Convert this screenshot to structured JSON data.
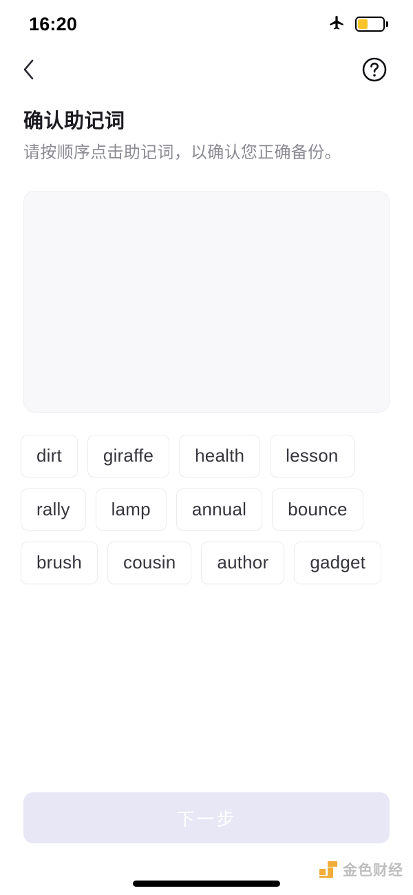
{
  "status_bar": {
    "time": "16:20",
    "airplane_icon": "airplane-mode-icon",
    "battery_icon": "battery-low-power-icon",
    "battery_level_percent": 40,
    "battery_color": "#f7c52b"
  },
  "nav": {
    "back_icon": "chevron-left-icon",
    "help_icon": "question-mark-circle-icon"
  },
  "header": {
    "title": "确认助记词",
    "subtitle": "请按顺序点击助记词，以确认您正确备份。"
  },
  "answer_box": {
    "selected_words": [],
    "placeholder": ""
  },
  "word_pool": {
    "words": [
      "dirt",
      "giraffe",
      "health",
      "lesson",
      "rally",
      "lamp",
      "annual",
      "bounce",
      "brush",
      "cousin",
      "author",
      "gadget"
    ]
  },
  "cta": {
    "label": "下一步",
    "enabled": false,
    "background": "#e7e7f6",
    "text_color": "#ffffff"
  },
  "watermark": {
    "text": "金色财经",
    "logo_color": "#f0a52a"
  }
}
